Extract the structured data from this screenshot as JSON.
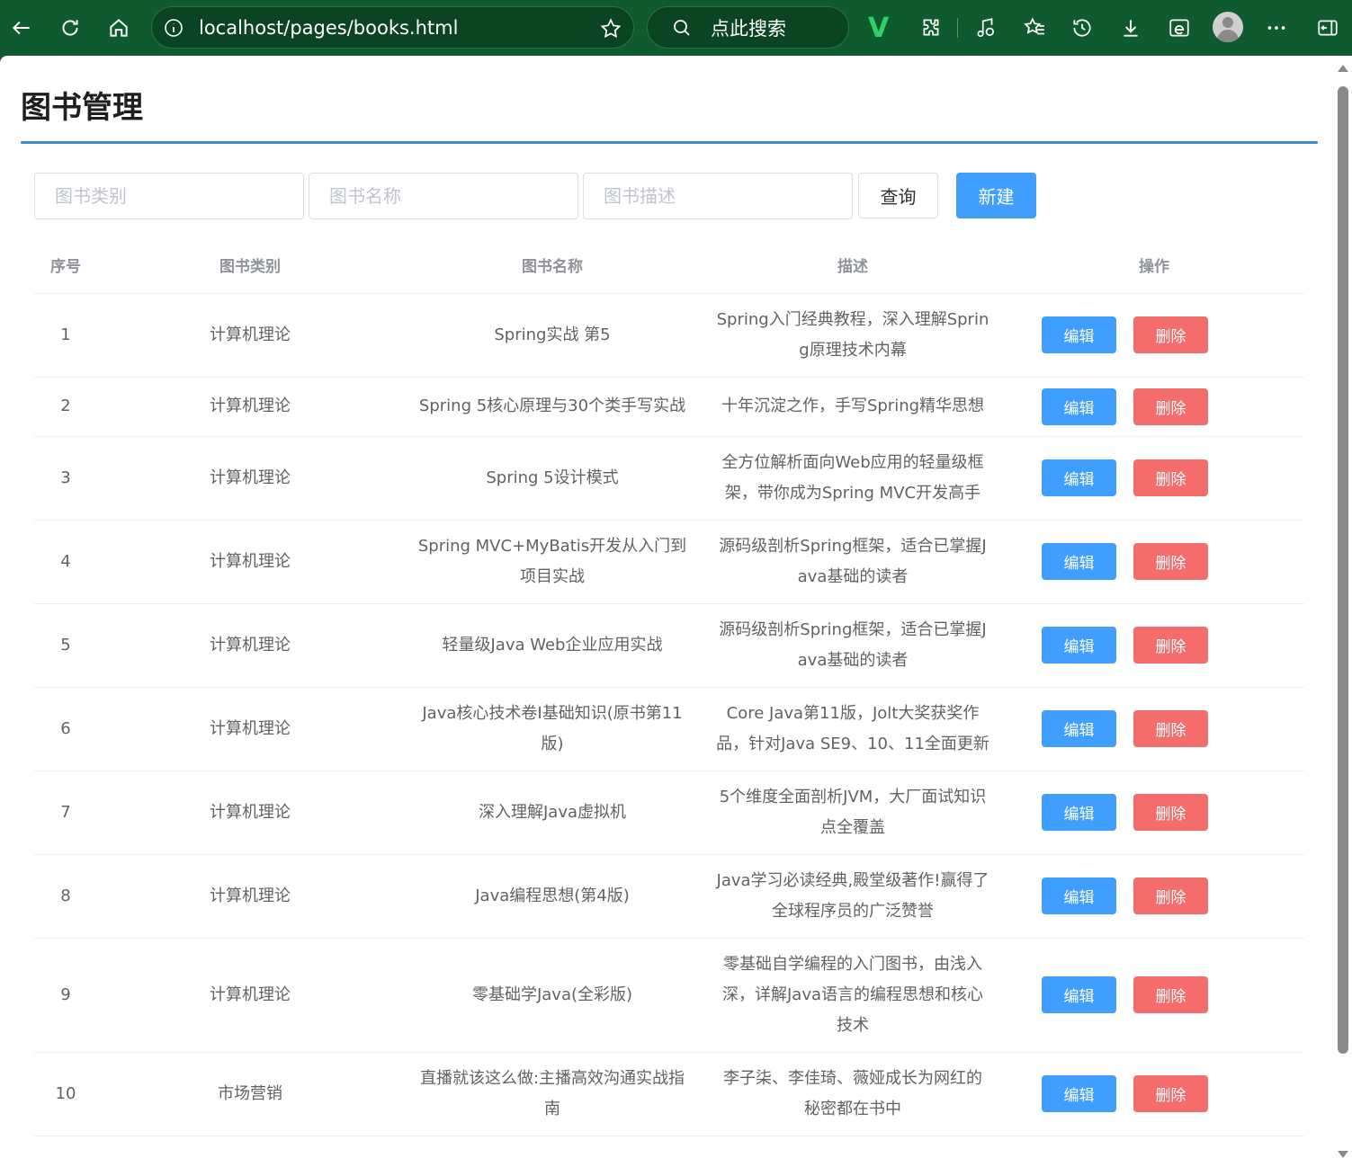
{
  "browser": {
    "url": "localhost/pages/books.html",
    "search_placeholder": "点此搜索",
    "v_logo": "V"
  },
  "page": {
    "title": "图书管理"
  },
  "filters": {
    "type_placeholder": "图书类别",
    "name_placeholder": "图书名称",
    "desc_placeholder": "图书描述",
    "query_label": "查询",
    "new_label": "新建"
  },
  "table": {
    "headers": [
      "序号",
      "图书类别",
      "图书名称",
      "描述",
      "操作"
    ],
    "edit_label": "编辑",
    "delete_label": "删除",
    "rows": [
      {
        "no": "1",
        "type": "计算机理论",
        "name": "Spring实战 第5",
        "desc": "Spring入门经典教程，深入理解Spring原理技术内幕"
      },
      {
        "no": "2",
        "type": "计算机理论",
        "name": "Spring 5核心原理与30个类手写实战",
        "desc": "十年沉淀之作，手写Spring精华思想"
      },
      {
        "no": "3",
        "type": "计算机理论",
        "name": "Spring 5设计模式",
        "desc": "全方位解析面向Web应用的轻量级框架，带你成为Spring MVC开发高手"
      },
      {
        "no": "4",
        "type": "计算机理论",
        "name": "Spring MVC+MyBatis开发从入门到项目实战",
        "desc": "源码级剖析Spring框架，适合已掌握Java基础的读者"
      },
      {
        "no": "5",
        "type": "计算机理论",
        "name": "轻量级Java Web企业应用实战",
        "desc": "源码级剖析Spring框架，适合已掌握Java基础的读者"
      },
      {
        "no": "6",
        "type": "计算机理论",
        "name": "Java核心技术卷I基础知识(原书第11版)",
        "desc": "Core Java第11版，Jolt大奖获奖作品，针对Java SE9、10、11全面更新"
      },
      {
        "no": "7",
        "type": "计算机理论",
        "name": "深入理解Java虚拟机",
        "desc": "5个维度全面剖析JVM，大厂面试知识点全覆盖"
      },
      {
        "no": "8",
        "type": "计算机理论",
        "name": "Java编程思想(第4版)",
        "desc": "Java学习必读经典,殿堂级著作!赢得了全球程序员的广泛赞誉"
      },
      {
        "no": "9",
        "type": "计算机理论",
        "name": "零基础学Java(全彩版)",
        "desc": "零基础自学编程的入门图书，由浅入深，详解Java语言的编程思想和核心技术"
      },
      {
        "no": "10",
        "type": "市场营销",
        "name": "直播就该这么做:主播高效沟通实战指南",
        "desc": "李子柒、李佳琦、薇娅成长为网红的秘密都在书中"
      }
    ]
  }
}
